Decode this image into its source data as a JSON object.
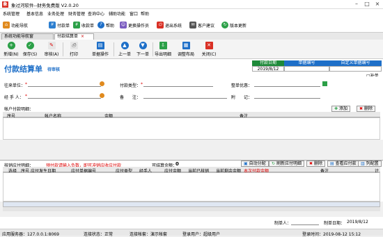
{
  "window": {
    "title": "象过河软件--财务免费版 V2.0.20",
    "app_icon": "象"
  },
  "menu": [
    "系统管理",
    "基本信息",
    "业务处理",
    "财务管理",
    "查询中心",
    "辅助功能",
    "窗口",
    "帮助"
  ],
  "quick": [
    "功能导航",
    "付款单",
    "收款单",
    "帮助",
    "更换操作员",
    "退出系统",
    "客户建议",
    "版本更新"
  ],
  "tabs": [
    "系统功能导航窗",
    "付款结算单"
  ],
  "toolbar": [
    "新增(N)",
    "保存(S)",
    "审核(A)",
    "打印",
    "单据操作",
    "上一单",
    "下一单",
    "导出明细",
    "调整布局",
    "关闭(C)"
  ],
  "header": {
    "title": "付款结算单",
    "status": "待审核",
    "col1": "付款日期",
    "col2": "单据编号",
    "col3": "自定义单据编号",
    "date": "2019/8/12",
    "extra": "□补单"
  },
  "form": {
    "supplier": "往来单位：",
    "payment_type": "付款类型：",
    "discount": "整单优惠：",
    "handler": "经 手 人：",
    "note": "备　　注：",
    "memo": "附　　记：",
    "req": "*"
  },
  "account": {
    "title": "帐户付款明细：",
    "add": "添加",
    "delete": "删除",
    "cols": [
      "序号",
      "帐户名称",
      "金额",
      "备注"
    ]
  },
  "verify": {
    "title": "核销应付明细：",
    "tip": "预付款请输入负数，即可冲销应收应付款",
    "amount_label": "可结算金额：",
    "amount": "0",
    "auto": "自动分配",
    "refresh": "刷新应付明细",
    "del": "删除",
    "view": "查看应付款",
    "config": "列配置",
    "cols": [
      "选择",
      "序号",
      "应付发生日期",
      "应付单据编号",
      "应付类型",
      "经手人",
      "应付金额",
      "当前已核销",
      "当前剩余金额",
      "本次付款金额",
      "备注",
      "计"
    ]
  },
  "footer": {
    "maker_label": "制单人：",
    "date_label": "制单日期：",
    "date": "2019/8/12"
  },
  "status": {
    "server": "应用服务器：127.0.0.1:8069",
    "conn": "连接状态：正常",
    "account": "连接帐套：演示帐套",
    "user": "登录用户：超级用户",
    "time": "登录时间：2019-08-12 15:12"
  }
}
